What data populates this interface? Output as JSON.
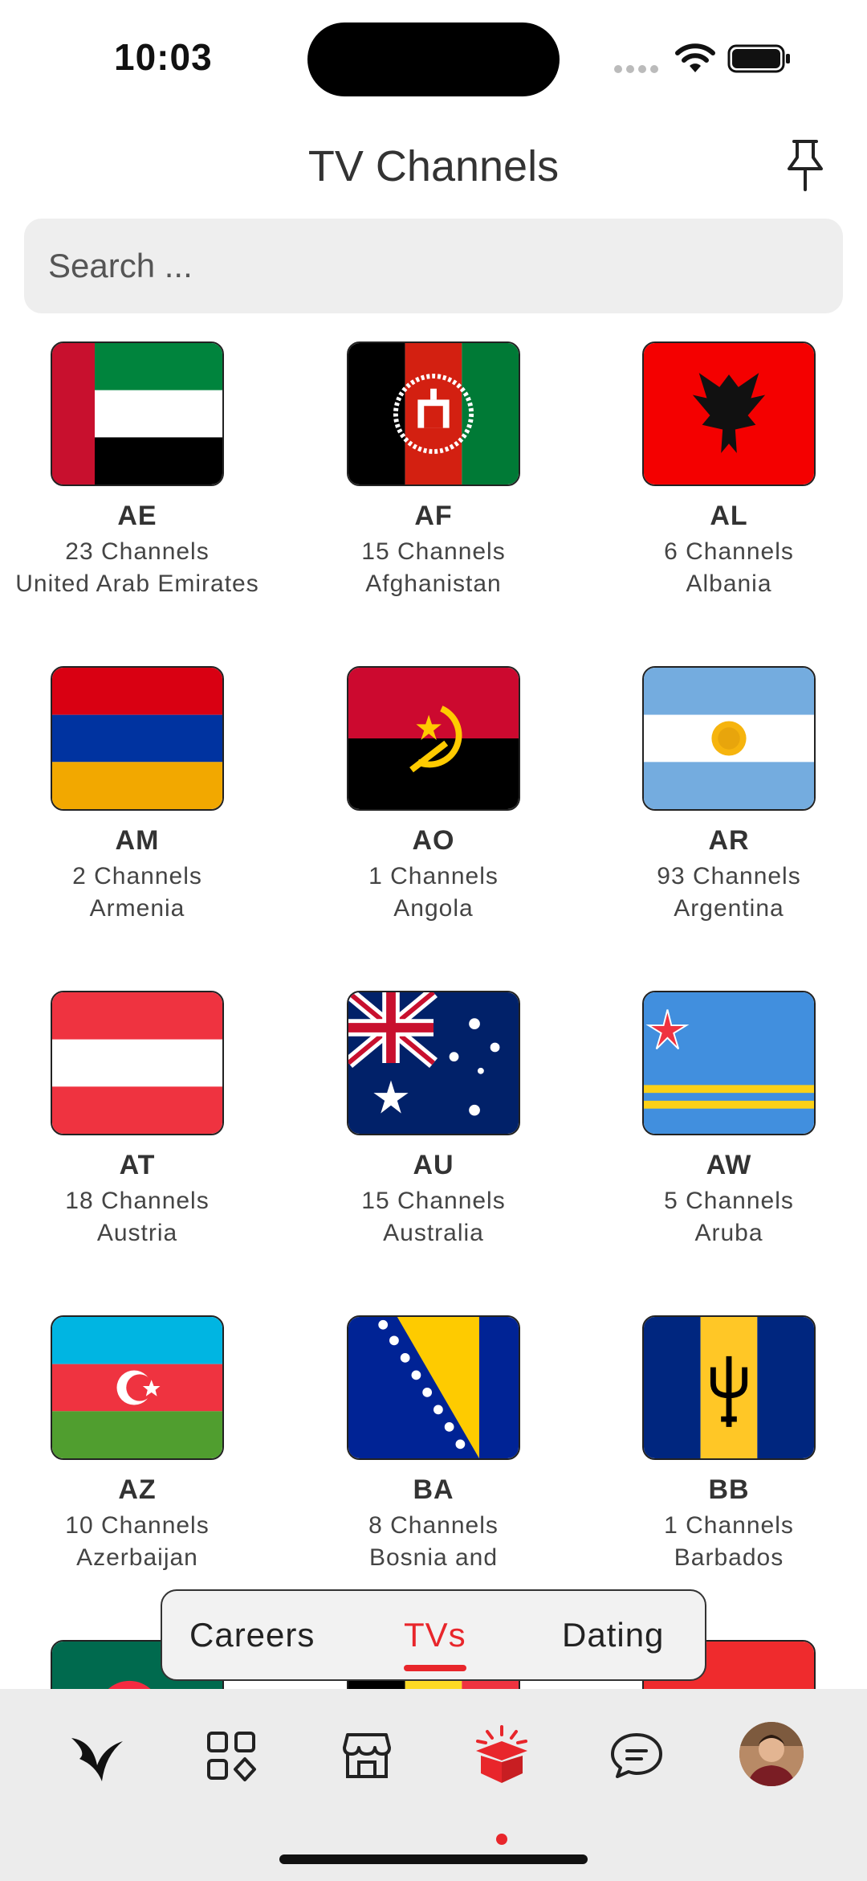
{
  "status_bar": {
    "time": "10:03"
  },
  "header": {
    "title": "TV Channels",
    "pin_icon": "pin-icon"
  },
  "search": {
    "placeholder": "Search ..."
  },
  "countries": [
    {
      "code": "AE",
      "channels": "23 Channels",
      "name": "United Arab Emirates",
      "flag": "flag-ae"
    },
    {
      "code": "AF",
      "channels": "15 Channels",
      "name": "Afghanistan",
      "flag": "flag-af"
    },
    {
      "code": "AL",
      "channels": "6 Channels",
      "name": "Albania",
      "flag": "flag-al"
    },
    {
      "code": "AM",
      "channels": "2 Channels",
      "name": "Armenia",
      "flag": "flag-am"
    },
    {
      "code": "AO",
      "channels": "1 Channels",
      "name": "Angola",
      "flag": "flag-ao"
    },
    {
      "code": "AR",
      "channels": "93 Channels",
      "name": "Argentina",
      "flag": "flag-ar"
    },
    {
      "code": "AT",
      "channels": "18 Channels",
      "name": "Austria",
      "flag": "flag-at"
    },
    {
      "code": "AU",
      "channels": "15 Channels",
      "name": "Australia",
      "flag": "flag-au"
    },
    {
      "code": "AW",
      "channels": "5 Channels",
      "name": "Aruba",
      "flag": "flag-aw"
    },
    {
      "code": "AZ",
      "channels": "10 Channels",
      "name": "Azerbaijan",
      "flag": "flag-az"
    },
    {
      "code": "BA",
      "channels": "8 Channels",
      "name": "Bosnia and",
      "flag": "flag-ba"
    },
    {
      "code": "BB",
      "channels": "1 Channels",
      "name": "Barbados",
      "flag": "flag-bb"
    }
  ],
  "segment_tabs": [
    {
      "label": "Careers",
      "active": false
    },
    {
      "label": "TVs",
      "active": true
    },
    {
      "label": "Dating",
      "active": false
    }
  ],
  "bottom_nav": [
    {
      "icon": "logo-icon",
      "active": false
    },
    {
      "icon": "apps-grid-icon",
      "active": false
    },
    {
      "icon": "store-icon",
      "active": false
    },
    {
      "icon": "gift-box-icon",
      "active": true
    },
    {
      "icon": "chat-icon",
      "active": false
    },
    {
      "icon": "avatar",
      "active": false
    }
  ],
  "colors": {
    "accent": "#e8262b",
    "search_bg": "#eeeeee",
    "nav_bg": "#ececec"
  }
}
